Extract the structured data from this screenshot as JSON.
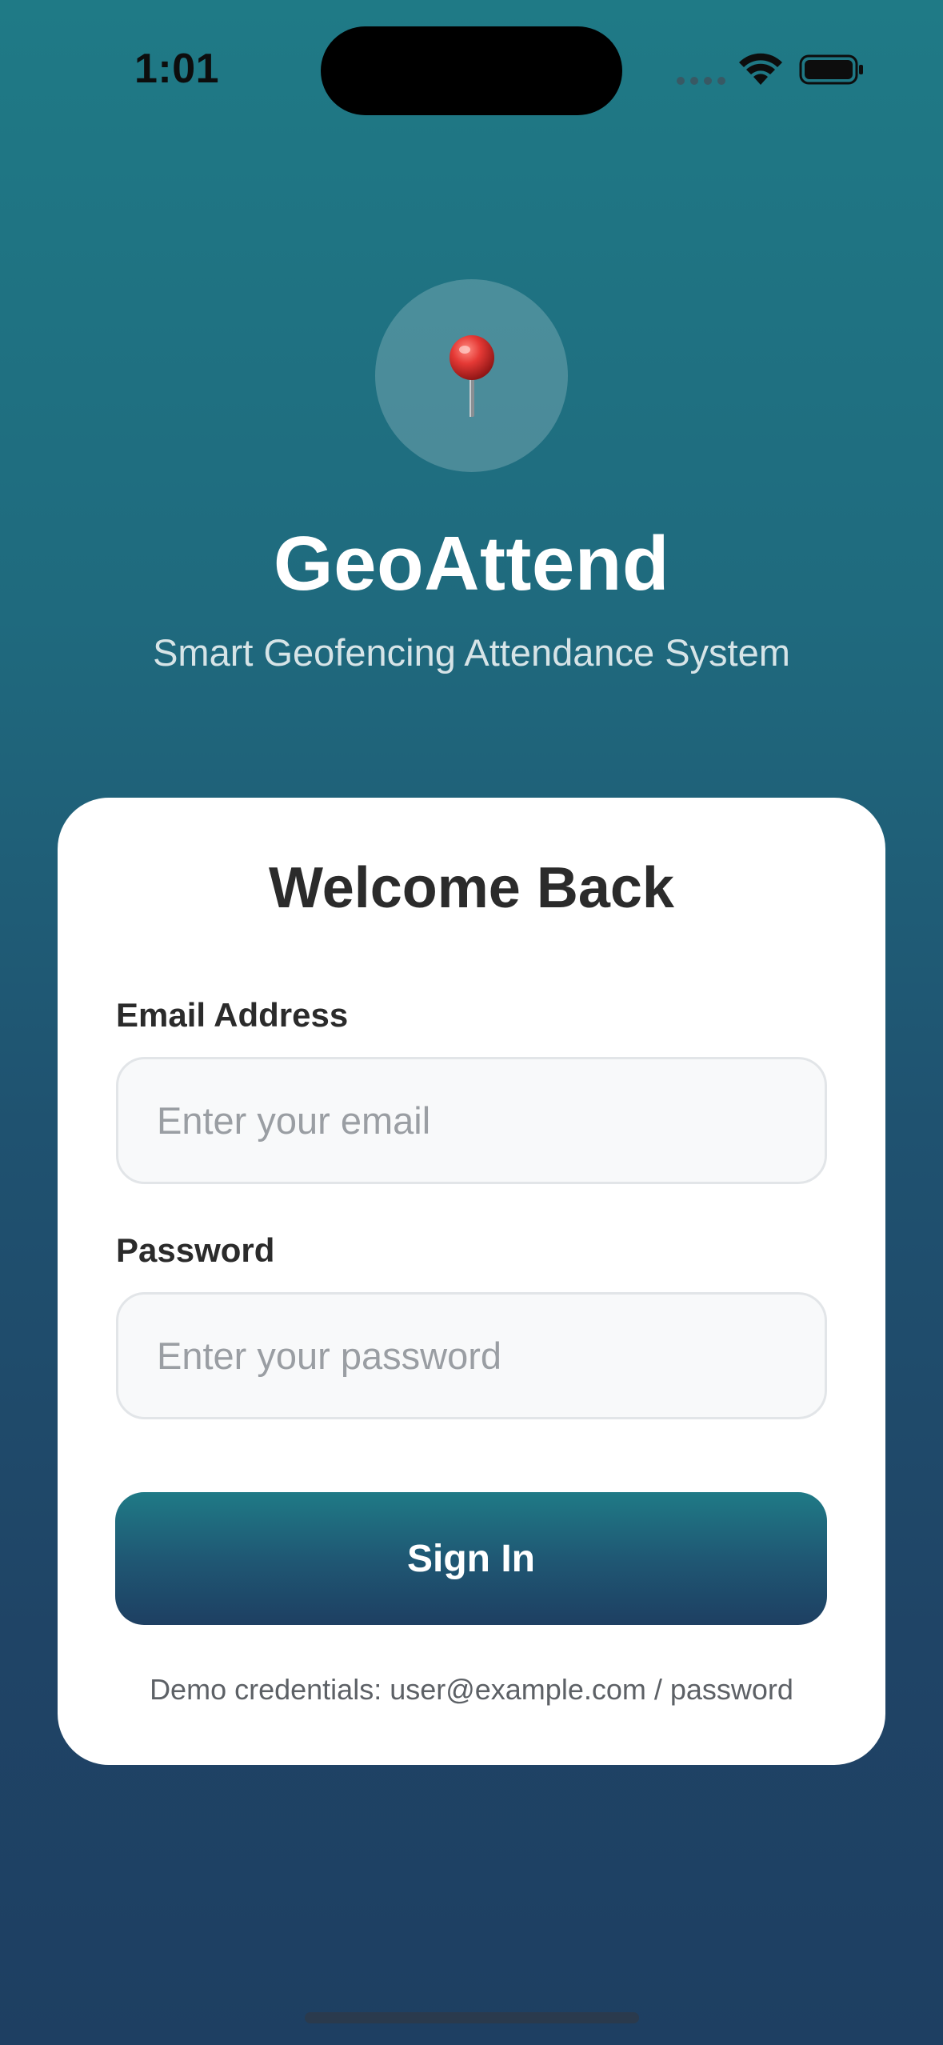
{
  "status_bar": {
    "time": "1:01"
  },
  "header": {
    "logo_icon": "round-pushpin-icon",
    "title": "GeoAttend",
    "subtitle": "Smart Geofencing Attendance System"
  },
  "login_card": {
    "title": "Welcome Back",
    "email": {
      "label": "Email Address",
      "value": "",
      "placeholder": "Enter your email"
    },
    "password": {
      "label": "Password",
      "value": "",
      "placeholder": "Enter your password"
    },
    "submit_label": "Sign In",
    "demo_note": "Demo credentials: user@example.com / password"
  },
  "colors": {
    "background_top": "#1f7a86",
    "background_bottom": "#1e3f62",
    "card": "#ffffff",
    "input_background": "#f8f9fa"
  }
}
